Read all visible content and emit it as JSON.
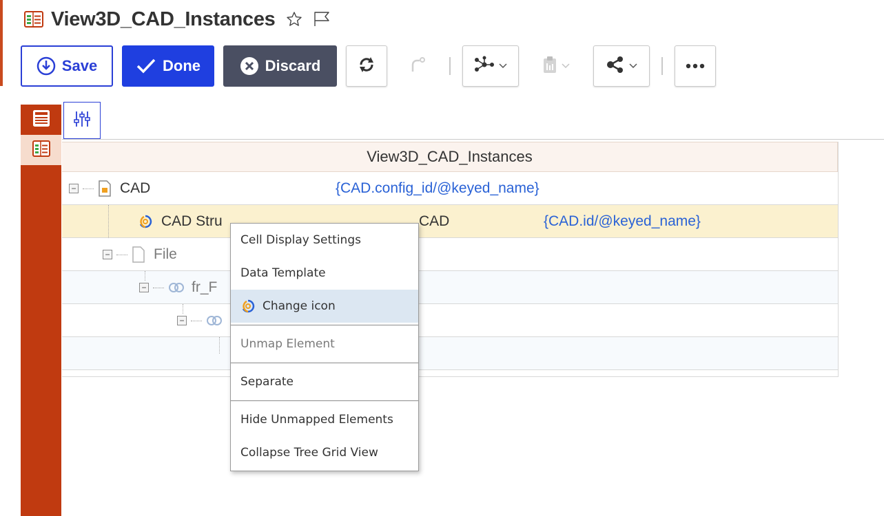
{
  "page": {
    "title": "View3D_CAD_Instances"
  },
  "toolbar": {
    "save_label": "Save",
    "done_label": "Done",
    "discard_label": "Discard"
  },
  "grid": {
    "header": "View3D_CAD_Instances",
    "rows": [
      {
        "name": "CAD",
        "value": "{CAD.config_id/@keyed_name}"
      },
      {
        "name": "CAD Stru",
        "mid": "CAD",
        "value": "{CAD.id/@keyed_name}"
      },
      {
        "name": "File"
      },
      {
        "name": "fr_F"
      },
      {
        "name": ""
      }
    ]
  },
  "context_menu": {
    "items": [
      "Cell Display Settings",
      "Data Template",
      "Change icon",
      "Unmap Element",
      "Separate",
      "Hide Unmapped Elements",
      "Collapse Tree Grid View"
    ]
  },
  "colors": {
    "accent": "#c03a10",
    "primary": "#1f3fe0",
    "discard": "#4a4f62",
    "selected_row": "#fbf1cf",
    "menu_highlight": "#dce7f2",
    "link": "#2a62d6"
  },
  "icons": {
    "title": "tree-grid-view-icon",
    "favorite": "star-outline-icon",
    "flag": "flag-outline-icon",
    "save": "power-arrow-icon",
    "done": "checkmark-icon",
    "discard": "close-circle-icon",
    "refresh": "refresh-icon",
    "redo": "redo-disabled-icon",
    "network": "network-graph-icon",
    "clipboard": "clipboard-icon",
    "share": "share-icon",
    "more": "more-icon",
    "settings": "sliders-icon"
  }
}
